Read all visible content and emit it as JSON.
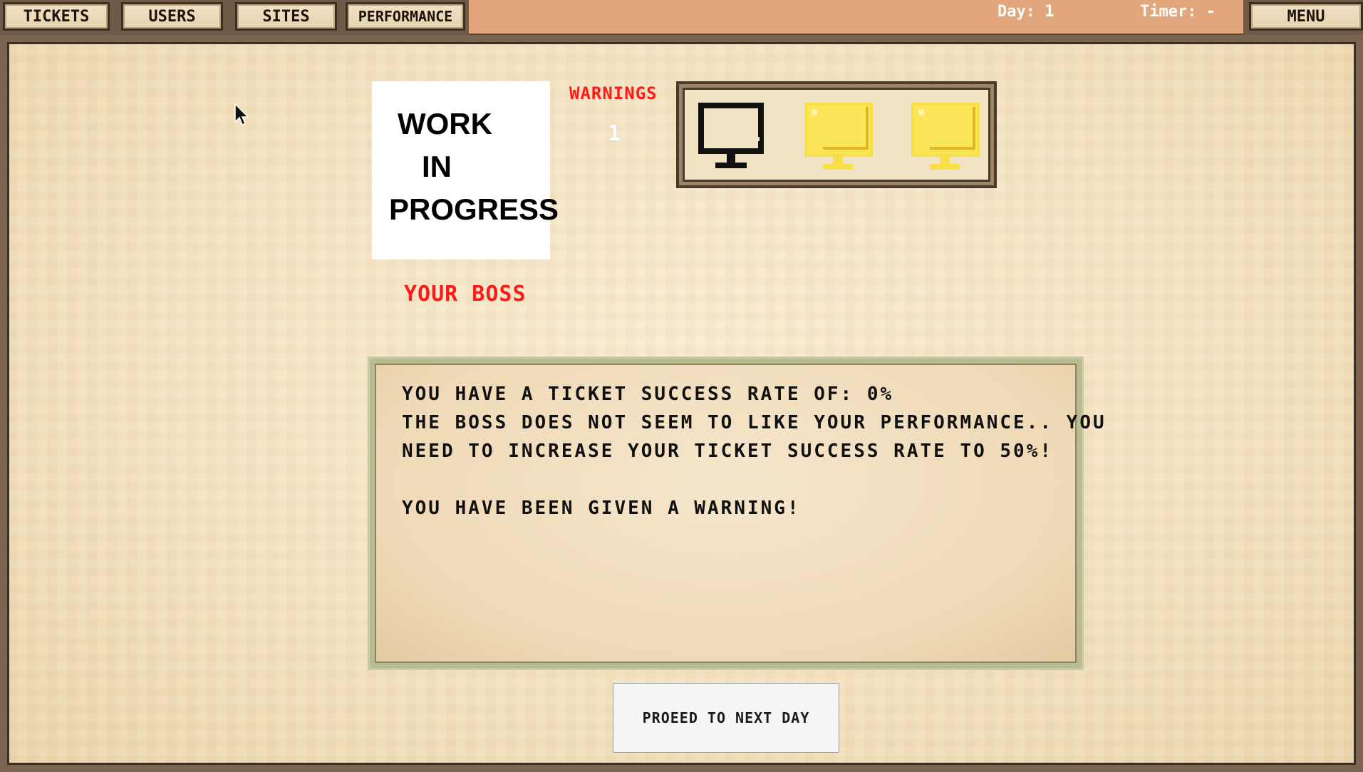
{
  "nav": {
    "tickets": "TICKETS",
    "users": "USERS",
    "sites": "SITES",
    "performance": "PERFORMANCE",
    "menu": "MENU"
  },
  "status": {
    "day": "Day: 1",
    "timer": "Timer: -"
  },
  "boss": {
    "image_text": [
      "WORK",
      "IN",
      "PROGRESS"
    ],
    "label": "YOUR BOSS"
  },
  "warnings": {
    "label": "WARNINGS",
    "count": "1",
    "max": 3,
    "used": 1
  },
  "message": {
    "lines": [
      "YOU HAVE A TICKET SUCCESS RATE OF: 0%",
      "THE BOSS DOES NOT SEEM TO LIKE YOUR PERFORMANCE.. YOU",
      "NEED TO INCREASE YOUR TICKET SUCCESS RATE TO 50%!",
      "",
      "YOU HAVE BEEN GIVEN A WARNING!"
    ]
  },
  "actions": {
    "next_day": "PROEED TO NEXT DAY"
  },
  "colors": {
    "accent_red": "#ff1a1a",
    "topbar": "#e2a67c",
    "monitor_active": "#222222",
    "monitor_remaining": "#f7df47"
  },
  "icons": {
    "cursor": "mouse-pointer-icon",
    "monitor": "monitor-icon"
  }
}
